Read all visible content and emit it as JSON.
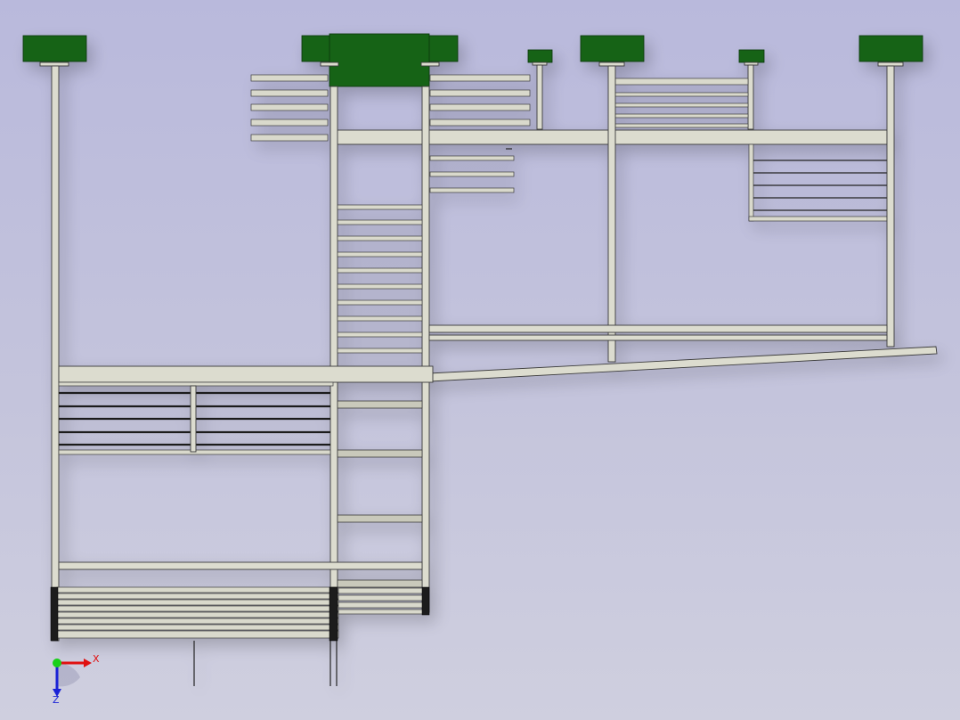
{
  "view": {
    "background_top": "#b9b9dc",
    "background_bottom": "#cfcfdf",
    "steel_color": "#dcdccf",
    "bracket_color": "#136313"
  },
  "triad": {
    "x_label": "X",
    "z_label": "Z",
    "x_color": "#e01010",
    "z_color": "#1a22d6",
    "origin_color": "#19d019"
  }
}
